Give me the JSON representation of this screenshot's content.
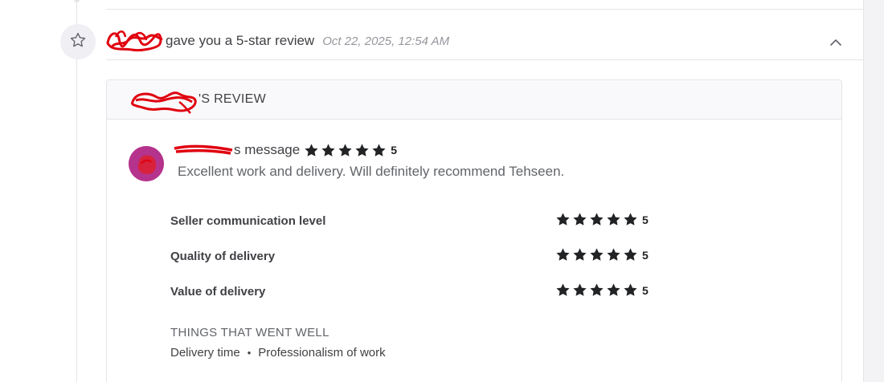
{
  "event": {
    "title": "gave you a 5-star review",
    "timestamp": "Oct 22, 2025, 12:54 AM"
  },
  "review": {
    "header_suffix": "'S REVIEW",
    "message_suffix": "s message",
    "overall_score": "5",
    "overall_stars": 5,
    "message": "Excellent work and delivery. Will definitely recommend Tehseen.",
    "criteria": [
      {
        "label": "Seller communication level",
        "stars": 5,
        "score": "5"
      },
      {
        "label": "Quality of delivery",
        "stars": 5,
        "score": "5"
      },
      {
        "label": "Value of delivery",
        "stars": 5,
        "score": "5"
      }
    ],
    "went_well_title": "THINGS THAT WENT WELL",
    "went_well": [
      "Delivery time",
      "Professionalism of work"
    ]
  },
  "icons": {
    "event_icon": "star-outline-icon",
    "collapse_icon": "chevron-up-icon",
    "rating_icon": "star-filled-icon"
  },
  "colors": {
    "redaction": "#e0000f",
    "avatar_bg": "#b5338c",
    "star": "#222325",
    "muted_text": "#95979d"
  }
}
